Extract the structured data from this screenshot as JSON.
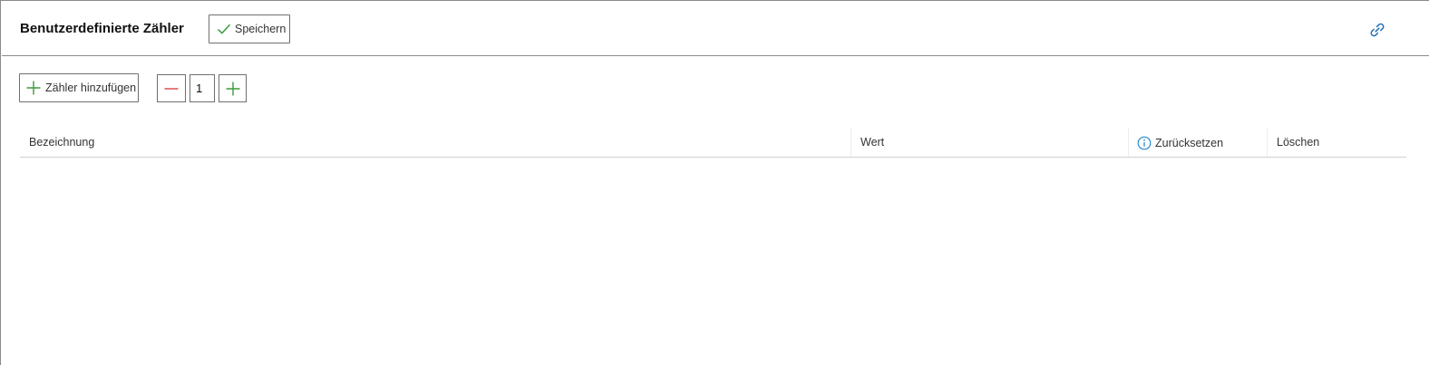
{
  "header": {
    "title": "Benutzerdefinierte Zähler",
    "save_label": "Speichern",
    "link_icon": "link-icon"
  },
  "toolbar": {
    "add_label": "Zähler hinzufügen",
    "stepper_value": "1"
  },
  "table": {
    "columns": [
      {
        "label": "Bezeichnung"
      },
      {
        "label": "Wert"
      },
      {
        "label": "Zurücksetzen",
        "icon": "info-icon"
      },
      {
        "label": "Löschen"
      }
    ],
    "rows": []
  },
  "colors": {
    "check_green": "#3a9a3a",
    "plus_green": "#3a9a3a",
    "minus_red": "#d64545",
    "link_blue": "#1f6fb5",
    "info_blue": "#2a8bd0"
  }
}
